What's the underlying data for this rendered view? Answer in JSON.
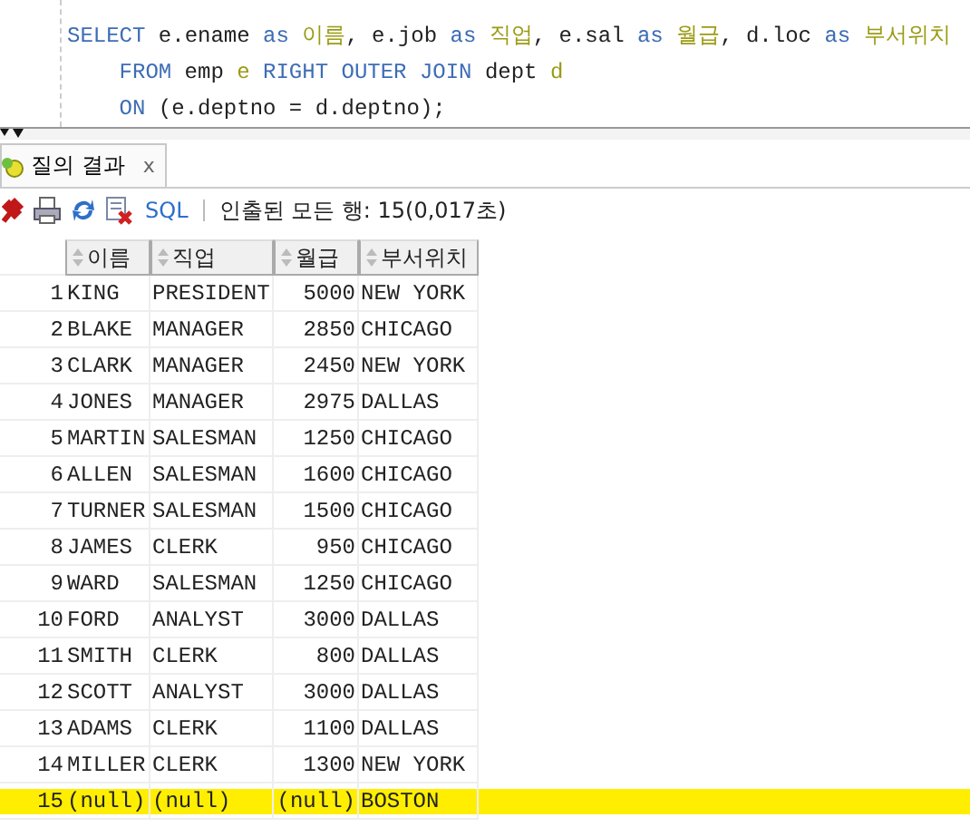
{
  "editor": {
    "lines": [
      [
        {
          "kind": "keyword",
          "text": "SELECT"
        },
        {
          "kind": "plain",
          "text": " e.ename "
        },
        {
          "kind": "keyword",
          "text": "as"
        },
        {
          "kind": "alias",
          "text": " 이름"
        },
        {
          "kind": "plain",
          "text": ", e.job "
        },
        {
          "kind": "keyword",
          "text": "as"
        },
        {
          "kind": "alias",
          "text": " 직업"
        },
        {
          "kind": "plain",
          "text": ", e.sal "
        },
        {
          "kind": "keyword",
          "text": "as"
        },
        {
          "kind": "alias",
          "text": " 월급"
        },
        {
          "kind": "plain",
          "text": ", d.loc "
        },
        {
          "kind": "keyword",
          "text": "as"
        },
        {
          "kind": "alias",
          "text": " 부서위치"
        }
      ],
      [
        {
          "kind": "keyword",
          "text": "    FROM"
        },
        {
          "kind": "plain",
          "text": " emp "
        },
        {
          "kind": "alias",
          "text": "e"
        },
        {
          "kind": "keyword",
          "text": " RIGHT OUTER JOIN"
        },
        {
          "kind": "plain",
          "text": " dept "
        },
        {
          "kind": "alias",
          "text": "d"
        }
      ],
      [
        {
          "kind": "keyword",
          "text": "    ON"
        },
        {
          "kind": "plain",
          "text": " (e.deptno = d.deptno);"
        }
      ]
    ]
  },
  "result_tab": {
    "label": "질의 결과",
    "close": "x"
  },
  "toolbar": {
    "sql": "SQL",
    "status": "인출된 모든 행: 15(0,017초)"
  },
  "table": {
    "columns": [
      "이름",
      "직업",
      "월급",
      "부서위치"
    ],
    "rows": [
      {
        "num": "1",
        "cells": [
          "KING",
          "PRESIDENT",
          "5000",
          "NEW YORK"
        ],
        "highlighted": false
      },
      {
        "num": "2",
        "cells": [
          "BLAKE",
          "MANAGER",
          "2850",
          "CHICAGO"
        ],
        "highlighted": false
      },
      {
        "num": "3",
        "cells": [
          "CLARK",
          "MANAGER",
          "2450",
          "NEW YORK"
        ],
        "highlighted": false
      },
      {
        "num": "4",
        "cells": [
          "JONES",
          "MANAGER",
          "2975",
          "DALLAS"
        ],
        "highlighted": false
      },
      {
        "num": "5",
        "cells": [
          "MARTIN",
          "SALESMAN",
          "1250",
          "CHICAGO"
        ],
        "highlighted": false
      },
      {
        "num": "6",
        "cells": [
          "ALLEN",
          "SALESMAN",
          "1600",
          "CHICAGO"
        ],
        "highlighted": false
      },
      {
        "num": "7",
        "cells": [
          "TURNER",
          "SALESMAN",
          "1500",
          "CHICAGO"
        ],
        "highlighted": false
      },
      {
        "num": "8",
        "cells": [
          "JAMES",
          "CLERK",
          "950",
          "CHICAGO"
        ],
        "highlighted": false
      },
      {
        "num": "9",
        "cells": [
          "WARD",
          "SALESMAN",
          "1250",
          "CHICAGO"
        ],
        "highlighted": false
      },
      {
        "num": "10",
        "cells": [
          "FORD",
          "ANALYST",
          "3000",
          "DALLAS"
        ],
        "highlighted": false
      },
      {
        "num": "11",
        "cells": [
          "SMITH",
          "CLERK",
          "800",
          "DALLAS"
        ],
        "highlighted": false
      },
      {
        "num": "12",
        "cells": [
          "SCOTT",
          "ANALYST",
          "3000",
          "DALLAS"
        ],
        "highlighted": false
      },
      {
        "num": "13",
        "cells": [
          "ADAMS",
          "CLERK",
          "1100",
          "DALLAS"
        ],
        "highlighted": false
      },
      {
        "num": "14",
        "cells": [
          "MILLER",
          "CLERK",
          "1300",
          "NEW YORK"
        ],
        "highlighted": false
      },
      {
        "num": "15",
        "cells": [
          "(null)",
          "(null)",
          "(null)",
          "BOSTON"
        ],
        "highlighted": true
      }
    ]
  }
}
